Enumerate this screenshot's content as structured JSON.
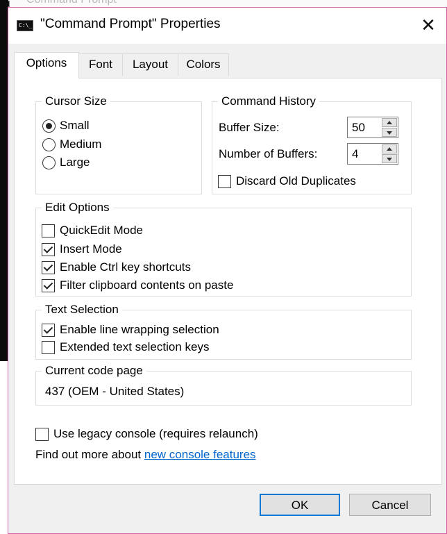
{
  "background": {
    "console_title": "Command Prompt"
  },
  "window": {
    "title": "\"Command Prompt\" Properties",
    "icon_text": "C:\\_",
    "close_glyph": "✕",
    "accent_color": "#0078d7",
    "link_color": "#0066cc"
  },
  "tabs": [
    {
      "label": "Options",
      "active": true
    },
    {
      "label": "Font",
      "active": false
    },
    {
      "label": "Layout",
      "active": false
    },
    {
      "label": "Colors",
      "active": false
    }
  ],
  "cursor_size": {
    "legend": "Cursor Size",
    "options": [
      {
        "label": "Small",
        "selected": true
      },
      {
        "label": "Medium",
        "selected": false
      },
      {
        "label": "Large",
        "selected": false
      }
    ]
  },
  "command_history": {
    "legend": "Command History",
    "buffer_size_label": "Buffer Size:",
    "buffer_size_value": "50",
    "num_buffers_label": "Number of Buffers:",
    "num_buffers_value": "4",
    "discard_label": "Discard Old Duplicates",
    "discard_checked": false
  },
  "edit_options": {
    "legend": "Edit Options",
    "items": [
      {
        "label": "QuickEdit Mode",
        "checked": false
      },
      {
        "label": "Insert Mode",
        "checked": true
      },
      {
        "label": "Enable Ctrl key shortcuts",
        "checked": true
      },
      {
        "label": "Filter clipboard contents on paste",
        "checked": true
      }
    ]
  },
  "text_selection": {
    "legend": "Text Selection",
    "items": [
      {
        "label": "Enable line wrapping selection",
        "checked": true
      },
      {
        "label": "Extended text selection keys",
        "checked": false
      }
    ]
  },
  "code_page": {
    "legend": "Current code page",
    "value": "437   (OEM - United States)"
  },
  "legacy": {
    "label": "Use legacy console (requires relaunch)",
    "checked": false
  },
  "find_out": {
    "prefix": "Find out more about ",
    "link_text": "new console features"
  },
  "buttons": {
    "ok": "OK",
    "cancel": "Cancel"
  }
}
